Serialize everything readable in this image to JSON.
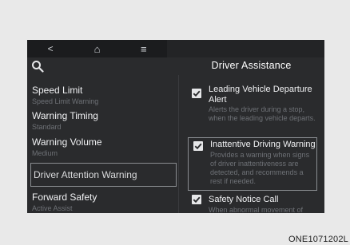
{
  "header": {
    "title": "Driver Assistance",
    "nav": [
      {
        "icon": "back-icon",
        "glyph": "<"
      },
      {
        "icon": "home-icon",
        "glyph": "⌂"
      },
      {
        "icon": "menu-icon",
        "glyph": "≡"
      }
    ],
    "search_icon": "search-icon"
  },
  "menu": {
    "items": [
      {
        "label": "Speed Limit",
        "sub": "Speed Limit Warning"
      },
      {
        "label": "Warning Timing",
        "sub": "Standard"
      },
      {
        "label": "Warning Volume",
        "sub": "Medium"
      },
      {
        "label": "Driver Attention Warning",
        "sub": ""
      },
      {
        "label": "Forward Safety",
        "sub": "Active Assist"
      }
    ]
  },
  "options": [
    {
      "label": "Leading Vehicle Departure Alert",
      "desc": "Alerts the driver during a stop, when the leading vehicle departs.",
      "checked": true
    },
    {
      "label": "Inattentive Driving Warning",
      "desc": "Provides a warning when signs of driver inattentiveness are detected, and recommends a rest if needed.",
      "checked": true
    },
    {
      "label": "Safety Notice Call",
      "desc": "When abnormal movement of",
      "checked": true
    }
  ],
  "caption": "ONE1071202L",
  "colors": {
    "background": "#2a2b2d",
    "accent": "#e6e7e9"
  }
}
